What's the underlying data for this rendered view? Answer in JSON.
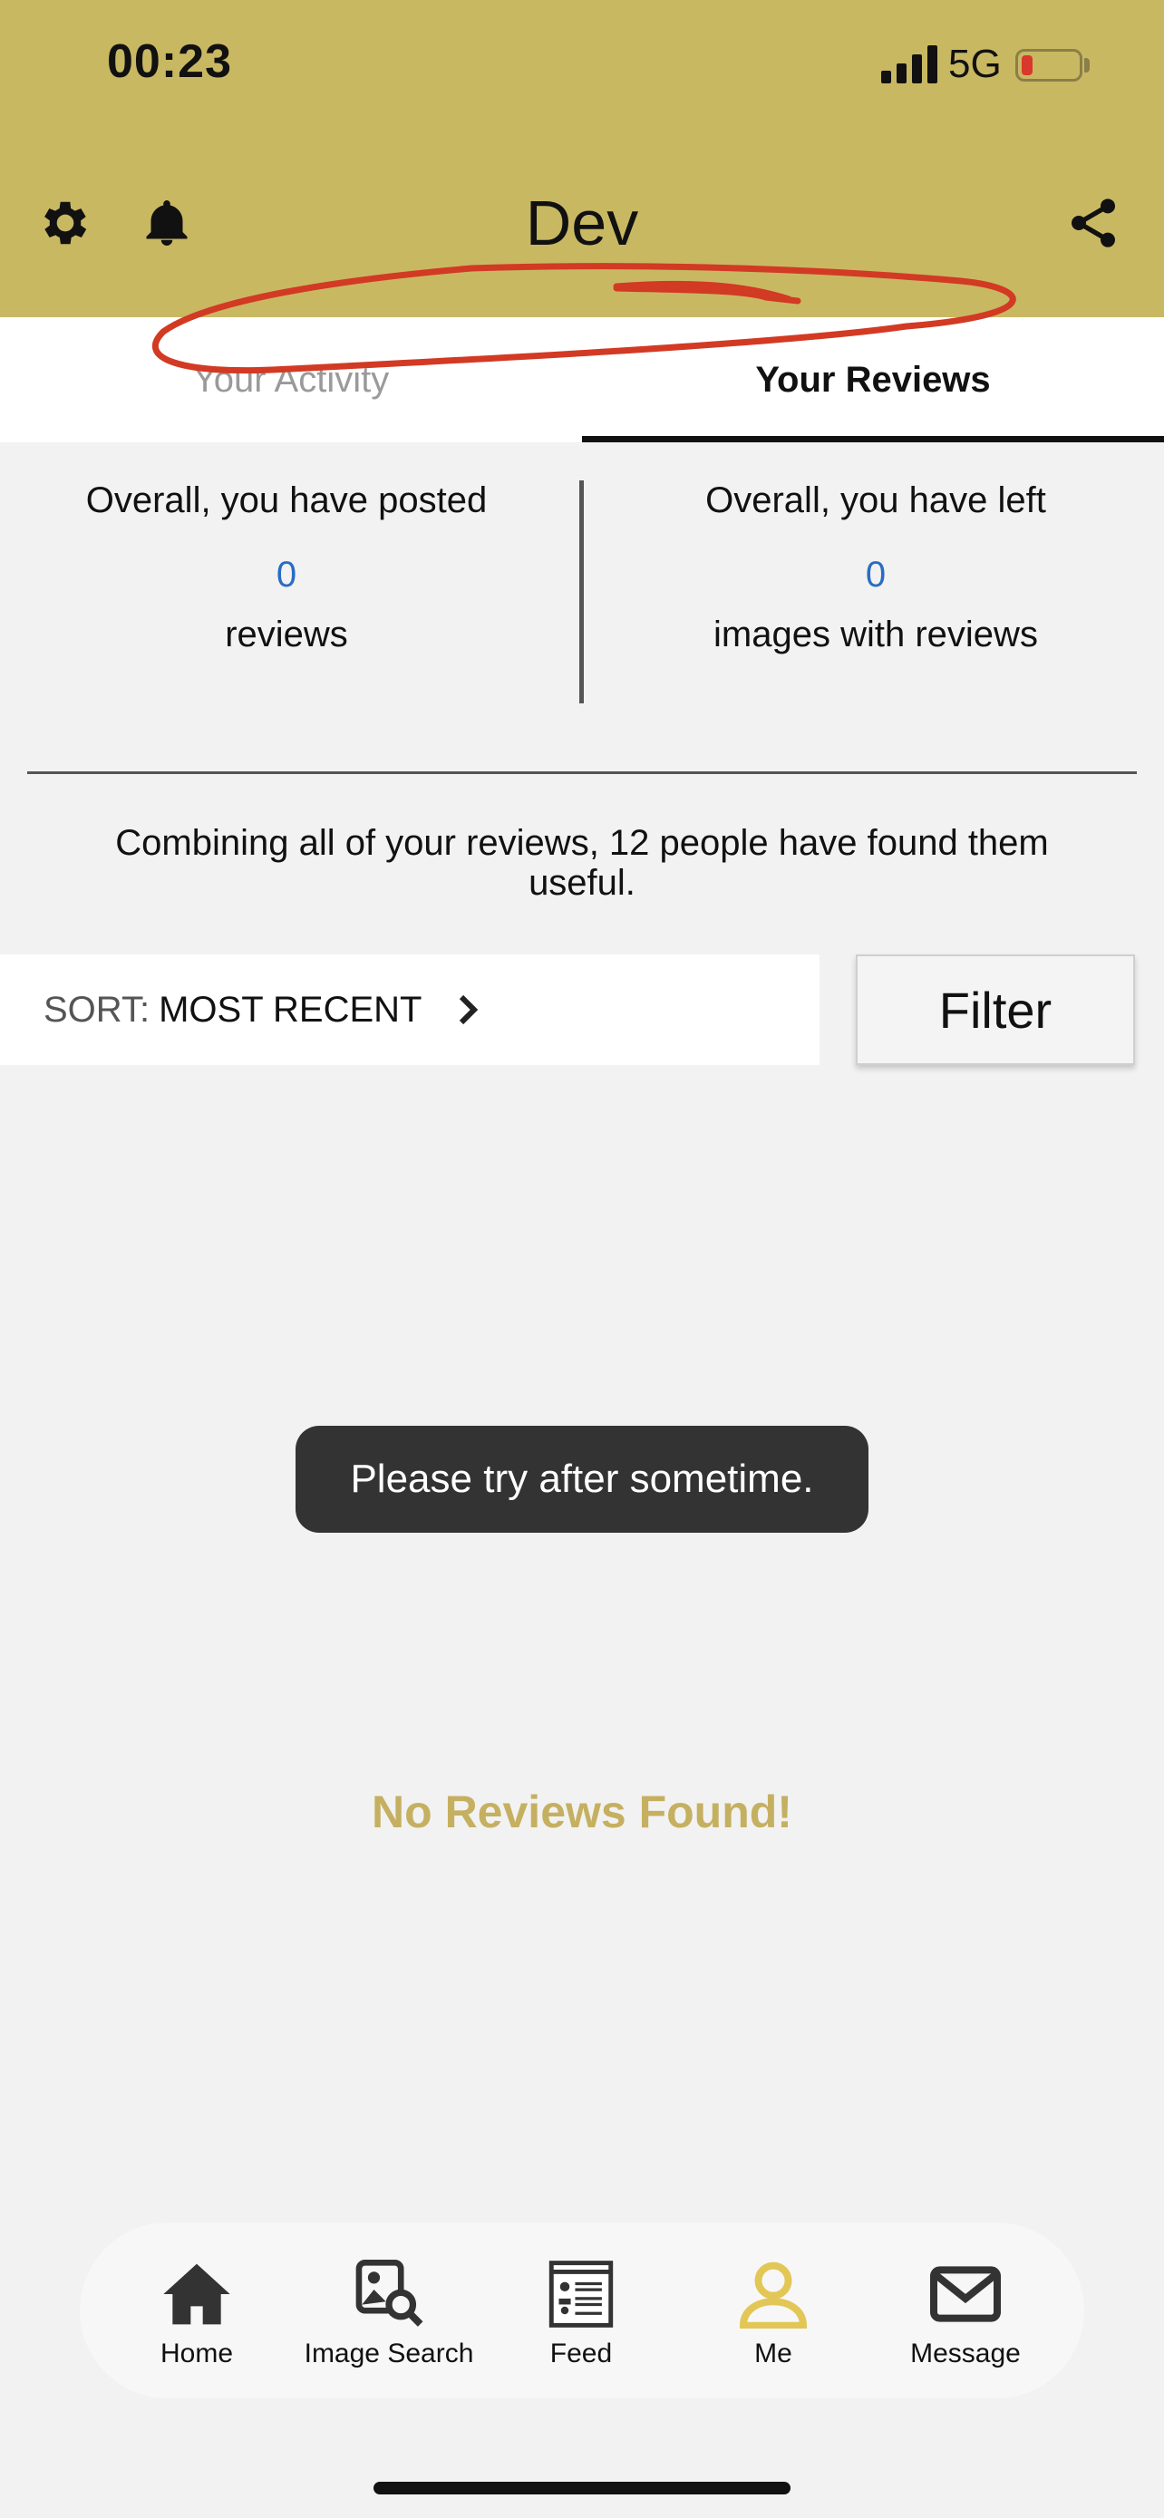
{
  "status_bar": {
    "time": "00:23",
    "network": "5G"
  },
  "header": {
    "title": "Dev"
  },
  "tabs": [
    {
      "label": "Your Activity"
    },
    {
      "label": "Your Reviews"
    }
  ],
  "stats": {
    "posted": {
      "line1": "Overall, you have posted",
      "count": "0",
      "line3": "reviews"
    },
    "left": {
      "line1": "Overall, you have left",
      "count": "0",
      "line3": "images with reviews"
    }
  },
  "combined_text": "Combining all of your reviews, 12 people have found them useful.",
  "sort": {
    "label": "SORT:",
    "value": "MOST RECENT"
  },
  "filter": {
    "label": "Filter"
  },
  "toast": "Please try after sometime.",
  "empty_state": "No Reviews Found!",
  "nav": [
    {
      "label": "Home",
      "icon": "home-icon"
    },
    {
      "label": "Image Search",
      "icon": "image-search-icon"
    },
    {
      "label": "Feed",
      "icon": "feed-icon"
    },
    {
      "label": "Me",
      "icon": "person-icon"
    },
    {
      "label": "Message",
      "icon": "mail-icon"
    }
  ],
  "colors": {
    "header": "#c9b862",
    "accent": "#c5b061",
    "link": "#2a6cc4",
    "annotation": "#d23a24"
  }
}
